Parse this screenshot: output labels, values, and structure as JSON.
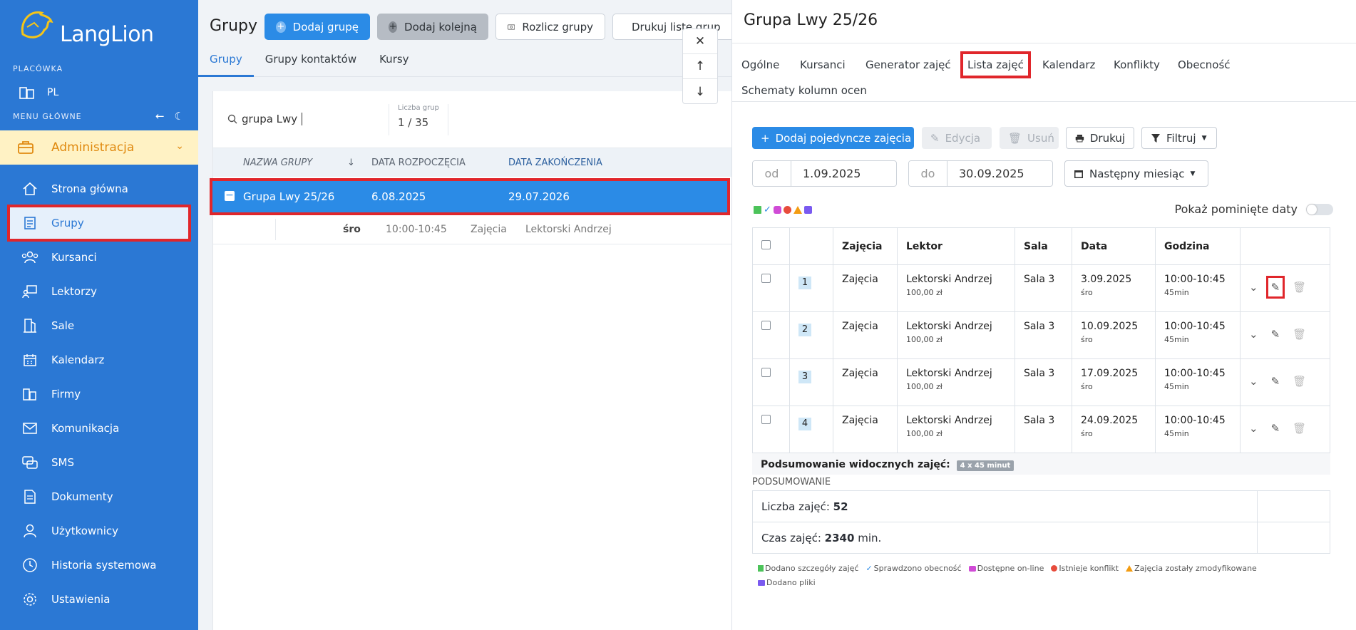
{
  "sidebar": {
    "logo_text": "LangLion",
    "placowka_label": "PLACÓWKA",
    "branch": "PL",
    "menu_label": "MENU GŁÓWNE",
    "admin_label": "Administracja",
    "items": [
      {
        "label": "Strona główna",
        "icon": "home-icon"
      },
      {
        "label": "Grupy",
        "icon": "groups-icon"
      },
      {
        "label": "Kursanci",
        "icon": "students-icon"
      },
      {
        "label": "Lektorzy",
        "icon": "teachers-icon"
      },
      {
        "label": "Sale",
        "icon": "rooms-icon"
      },
      {
        "label": "Kalendarz",
        "icon": "calendar-icon"
      },
      {
        "label": "Firmy",
        "icon": "companies-icon"
      },
      {
        "label": "Komunikacja",
        "icon": "mail-icon"
      },
      {
        "label": "SMS",
        "icon": "sms-icon"
      },
      {
        "label": "Dokumenty",
        "icon": "document-icon"
      },
      {
        "label": "Użytkownicy",
        "icon": "user-icon"
      },
      {
        "label": "Historia systemowa",
        "icon": "history-icon"
      },
      {
        "label": "Ustawienia",
        "icon": "settings-icon"
      }
    ]
  },
  "groups": {
    "title": "Grupy",
    "buttons": {
      "add_group": "Dodaj grupę",
      "add_next": "Dodaj kolejną",
      "settle": "Rozlicz grupy",
      "print": "Drukuj listę grup"
    },
    "tabs": [
      "Grupy",
      "Grupy kontaktów",
      "Kursy"
    ],
    "search_value": "grupa Lwy",
    "counter_label": "Liczba grup",
    "counter_value": "1 / 35",
    "columns": [
      "NAZWA GRUPY",
      "DATA ROZPOCZĘCIA",
      "DATA ZAKOŃCZENIA"
    ],
    "row": {
      "name": "Grupa Lwy 25/26",
      "start": "6.08.2025",
      "end": "29.07.2026"
    },
    "sub_row": {
      "day": "śro",
      "time": "10:00-10:45",
      "type": "Zajęcia",
      "teacher": "Lektorski Andrzej"
    }
  },
  "detail": {
    "title": "Grupa Lwy 25/26",
    "tabs": [
      "Ogólne",
      "Kursanci",
      "Generator zajęć",
      "Lista zajęć",
      "Kalendarz",
      "Konflikty",
      "Obecność",
      "Schematy kolumn ocen"
    ],
    "toolbar": {
      "add": "Dodaj pojedyncze zajęcia",
      "edit": "Edycja",
      "delete": "Usuń",
      "print": "Drukuj",
      "filter": "Filtruj"
    },
    "from_label": "od",
    "from_value": "1.09.2025",
    "to_label": "do",
    "to_value": "30.09.2025",
    "period": "Następny miesiąc",
    "show_skipped": "Pokaż pominięte daty",
    "columns": [
      "Zajęcia",
      "Lektor",
      "Sala",
      "Data",
      "Godzina"
    ],
    "lessons": [
      {
        "num": "1",
        "type": "Zajęcia",
        "teacher": "Lektorski Andrzej",
        "price": "100,00 zł",
        "room": "Sala 3",
        "date": "3.09.2025",
        "day": "śro",
        "time": "10:00-10:45",
        "duration": "45min"
      },
      {
        "num": "2",
        "type": "Zajęcia",
        "teacher": "Lektorski Andrzej",
        "price": "100,00 zł",
        "room": "Sala 3",
        "date": "10.09.2025",
        "day": "śro",
        "time": "10:00-10:45",
        "duration": "45min"
      },
      {
        "num": "3",
        "type": "Zajęcia",
        "teacher": "Lektorski Andrzej",
        "price": "100,00 zł",
        "room": "Sala 3",
        "date": "17.09.2025",
        "day": "śro",
        "time": "10:00-10:45",
        "duration": "45min"
      },
      {
        "num": "4",
        "type": "Zajęcia",
        "teacher": "Lektorski Andrzej",
        "price": "100,00 zł",
        "room": "Sala 3",
        "date": "24.09.2025",
        "day": "śro",
        "time": "10:00-10:45",
        "duration": "45min"
      }
    ],
    "visible_summary": "Podsumowanie widocznych zajęć:",
    "visible_badge": "4 x 45 minut",
    "summary_header": "PODSUMOWANIE",
    "count_label": "Liczba zajęć:",
    "count_value": "52",
    "time_label": "Czas zajęć:",
    "time_value": "2340",
    "time_unit": "min.",
    "legend": [
      {
        "label": "Dodano szczegóły zajęć",
        "color": "#4cc35a"
      },
      {
        "label": "Sprawdzono obecność",
        "color": "#2b8be6"
      },
      {
        "label": "Dostępne on-line",
        "color": "#d04bd6"
      },
      {
        "label": "Istnieje konflikt",
        "color": "#e74c3c"
      },
      {
        "label": "Zajęcia zostały zmodyfikowane",
        "color": "#f39c12"
      },
      {
        "label": "Dodano pliki",
        "color": "#7a5af0"
      }
    ]
  },
  "colors": {
    "primary": "#2b8be6",
    "sidebar": "#2b78d4",
    "highlight": "#e0262b",
    "admin_bg": "#fff2c4"
  }
}
